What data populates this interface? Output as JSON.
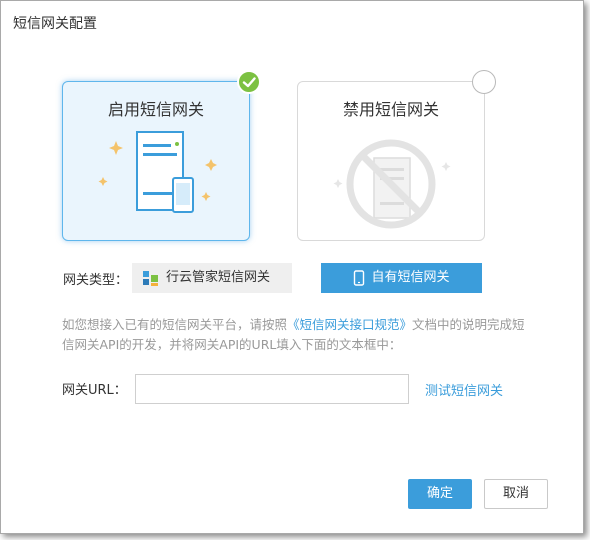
{
  "dialog": {
    "title": "短信网关配置"
  },
  "options": {
    "enabled_label": "启用短信网关",
    "disabled_label": "禁用短信网关",
    "selected": "enabled"
  },
  "gateway_type": {
    "label": "网关类型：",
    "options": [
      "行云管家短信网关",
      "自有短信网关"
    ],
    "selected": "自有短信网关"
  },
  "description": {
    "part1": "如您想接入已有的短信网关平台，请按照",
    "link": "《短信网关接口规范》",
    "part2": "文档中的说明完成短信网关API的开发，并将网关API的URL填入下面的文本框中："
  },
  "url": {
    "label": "网关URL：",
    "value": "",
    "test_link": "测试短信网关"
  },
  "buttons": {
    "ok": "确定",
    "cancel": "取消"
  },
  "colors": {
    "accent": "#3b9ddb",
    "check": "#7cc142"
  }
}
